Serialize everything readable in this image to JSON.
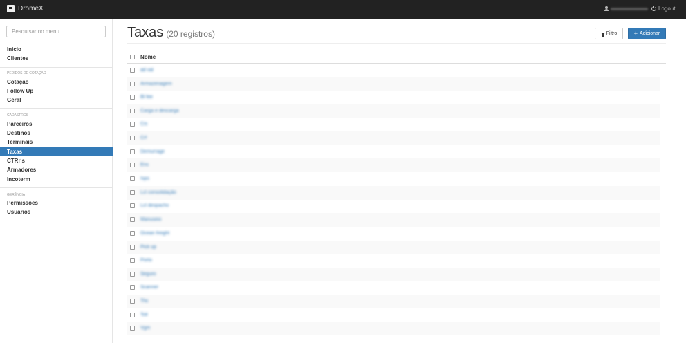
{
  "app": {
    "brand": "DromeX"
  },
  "topbar": {
    "logout_label": "Logout"
  },
  "sidebar": {
    "search_placeholder": "Pesquisar no menu",
    "items_top": [
      {
        "label": "Inicio"
      },
      {
        "label": "Clientes"
      }
    ],
    "section_pedidos": "Pedidos de cotação",
    "items_pedidos": [
      {
        "label": "Cotação"
      },
      {
        "label": "Follow Up"
      },
      {
        "label": "Geral"
      }
    ],
    "section_cadastros": "Cadastros",
    "items_cadastros": [
      {
        "label": "Parceiros"
      },
      {
        "label": "Destinos"
      },
      {
        "label": "Terminais"
      },
      {
        "label": "Taxas"
      },
      {
        "label": "CTRr's"
      },
      {
        "label": "Armadores"
      },
      {
        "label": "Incoterm"
      }
    ],
    "active_item": "Taxas",
    "section_gerencia": "Gerência",
    "items_gerencia": [
      {
        "label": "Permissões"
      },
      {
        "label": "Usuários"
      }
    ]
  },
  "main": {
    "title": "Taxas",
    "count": "(20 registros)",
    "filter_label": "Filtro",
    "add_label": "Adicionar",
    "table": {
      "column_header": "Nome",
      "rows": [
        {
          "name": "ad val"
        },
        {
          "name": "Armazenagem"
        },
        {
          "name": "Bl fee"
        },
        {
          "name": "Carga e descarga"
        },
        {
          "name": "Cis"
        },
        {
          "name": "Crf"
        },
        {
          "name": "Demurrage"
        },
        {
          "name": "Ens"
        },
        {
          "name": "Isps"
        },
        {
          "name": "Lcl consolidação"
        },
        {
          "name": "Lcl despacho"
        },
        {
          "name": "Manuseio"
        },
        {
          "name": "Ocean freight"
        },
        {
          "name": "Pick up"
        },
        {
          "name": "Porto"
        },
        {
          "name": "Seguro"
        },
        {
          "name": "Scanner"
        },
        {
          "name": "Thc"
        },
        {
          "name": "Toll"
        },
        {
          "name": "Vgm"
        }
      ]
    }
  }
}
